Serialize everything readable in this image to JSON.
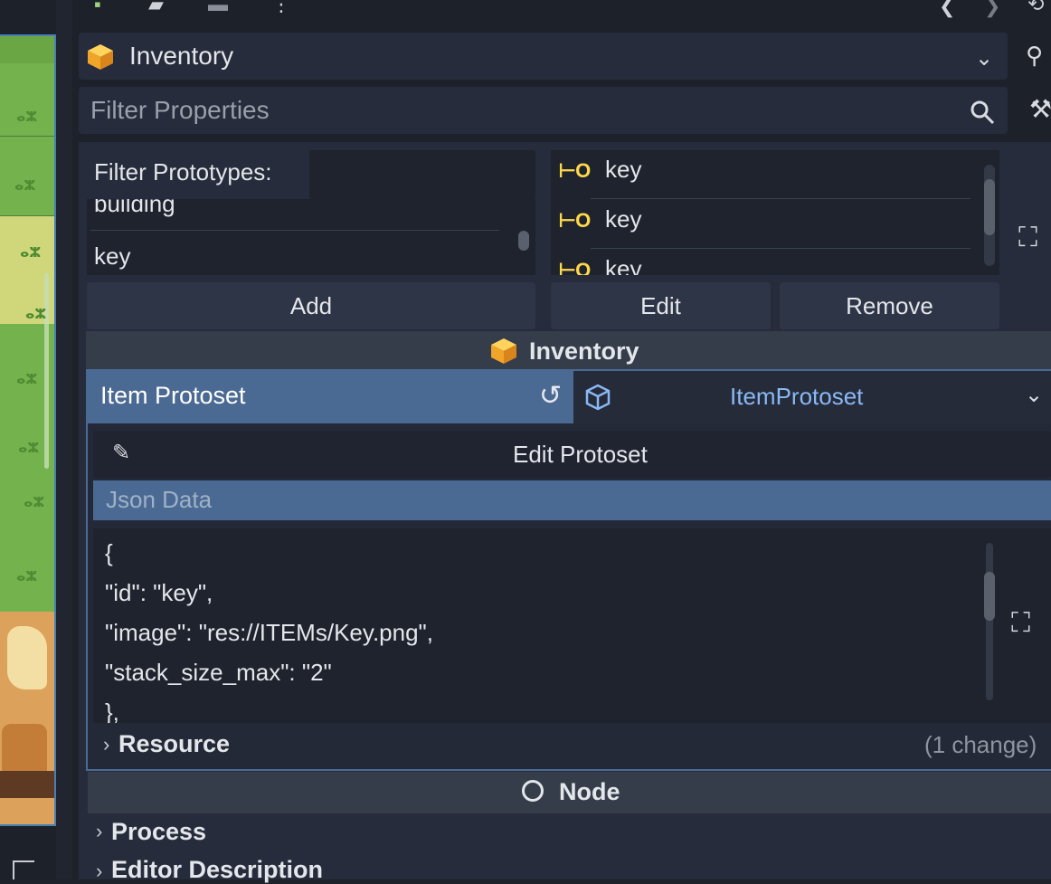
{
  "inspector": {
    "object_title": "Inventory",
    "filter_placeholder": "Filter Properties"
  },
  "protoset_editor": {
    "filter_label": "Filter Prototypes:",
    "prototypes": [
      "building",
      "key"
    ],
    "items": [
      "key",
      "key",
      "key"
    ],
    "buttons": {
      "add": "Add",
      "edit": "Edit",
      "remove": "Remove"
    }
  },
  "sections": {
    "inventory_header": "Inventory",
    "node_header": "Node"
  },
  "item_protoset": {
    "label": "Item Protoset",
    "value": "ItemProtoset",
    "edit_button": "Edit Protoset",
    "json_label": "Json Data",
    "json_lines": [
      "{",
      "\"id\": \"key\",",
      "\"image\": \"res://ITEMs/Key.png\",",
      "\"stack_size_max\": \"2\"",
      "},"
    ],
    "resource_label": "Resource",
    "resource_changes": "(1 change)"
  },
  "node_sections": {
    "process": "Process",
    "editor_description": "Editor Description"
  },
  "colors": {
    "accent": "#4b6a93",
    "link": "#8ab8f5",
    "key_icon": "#ffd84a",
    "background": "#1d2129"
  },
  "icons": [
    "new-script-icon",
    "load-icon",
    "save-icon",
    "more-icon",
    "back-icon",
    "forward-icon",
    "history-icon",
    "cube-icon",
    "dropdown-icon",
    "search-icon",
    "doc-icon",
    "tools-icon",
    "key-icon",
    "expand-icon",
    "revert-icon",
    "resource-icon",
    "pencil-icon",
    "chevron-right-icon",
    "node-icon"
  ]
}
